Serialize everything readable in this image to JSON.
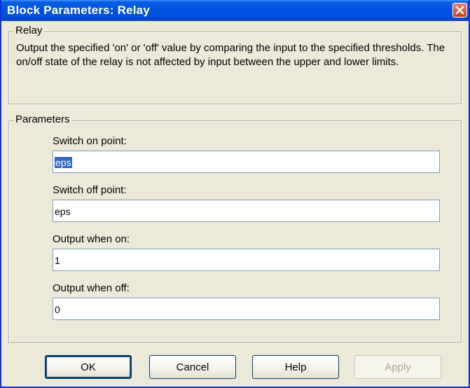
{
  "window": {
    "title": "Block Parameters: Relay"
  },
  "description_group": {
    "label": "Relay",
    "text": "Output the specified 'on' or 'off' value by comparing the input to the specified thresholds.  The on/off state of the relay is not affected by input between the upper and lower limits."
  },
  "parameters_group": {
    "label": "Parameters",
    "fields": [
      {
        "label": "Switch on point:",
        "value": "eps"
      },
      {
        "label": "Switch off point:",
        "value": "eps"
      },
      {
        "label": "Output when on:",
        "value": "1"
      },
      {
        "label": "Output when off:",
        "value": "0"
      }
    ]
  },
  "buttons": {
    "ok": "OK",
    "cancel": "Cancel",
    "help": "Help",
    "apply": "Apply"
  },
  "icons": {
    "close": "close-icon"
  },
  "colors": {
    "titlebar": "#0053e1",
    "face": "#ece9d8",
    "selection": "#316ac5",
    "close": "#c6401d"
  }
}
